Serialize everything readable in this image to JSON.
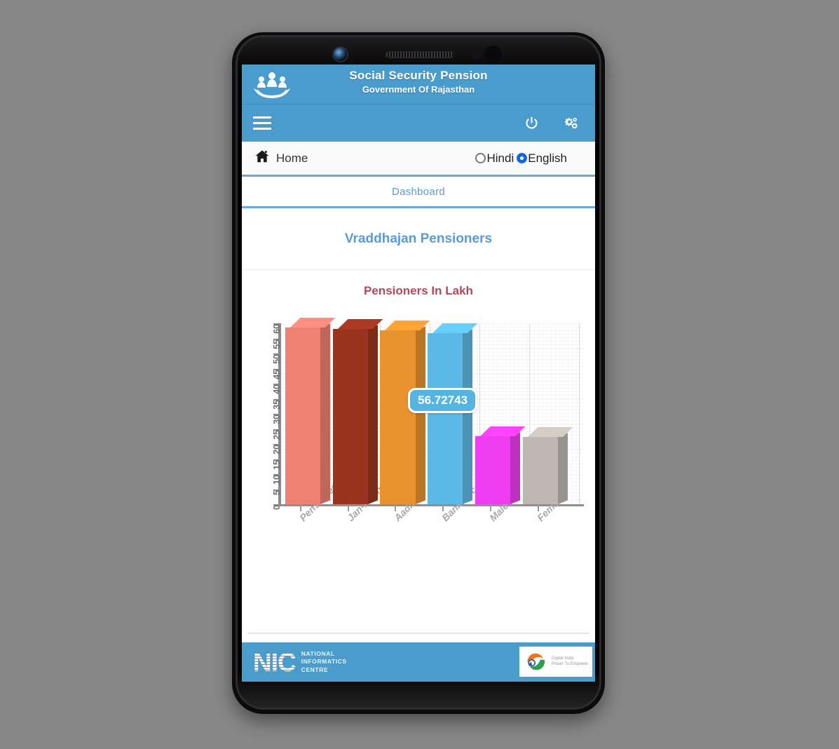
{
  "header": {
    "title": "Social Security Pension",
    "subtitle": "Government Of Rajasthan",
    "logo_name": "pension-emblem-hands-logo"
  },
  "navbar": {
    "menu_icon": "hamburger-icon",
    "power_icon": "power-icon",
    "settings_icon": "gears-icon"
  },
  "subbar": {
    "home_label": "Home",
    "home_icon": "home-icon",
    "languages": [
      {
        "label": "Hindi",
        "selected": false
      },
      {
        "label": "English",
        "selected": true
      }
    ]
  },
  "dashboard": {
    "tab_label": "Dashboard",
    "panel_title": "Vraddhajan Pensioners"
  },
  "chart_data": {
    "type": "bar",
    "title": "Pensioners In Lakh",
    "xlabel": "",
    "ylabel": "",
    "categories": [
      "Pensioner",
      "Jan-Aadhar",
      "Aadhar",
      "Bank Account",
      "Male",
      "Female"
    ],
    "values": [
      58.7,
      58.1,
      57.6,
      56.72743,
      22.5,
      22.3
    ],
    "colors": [
      "#ef8173",
      "#99341f",
      "#e8922f",
      "#5cb8e4",
      "#ee3df0",
      "#bdb8b2"
    ],
    "ylim": [
      0,
      60
    ],
    "yticks": [
      0,
      5,
      10,
      15,
      20,
      25,
      30,
      35,
      40,
      45,
      50,
      55,
      60
    ],
    "ytick_labels": [
      "0",
      "5",
      "10",
      "15",
      "20",
      "25",
      "30",
      "35",
      "40",
      "45",
      "50",
      "55",
      "60"
    ],
    "grid": true,
    "legend": "none",
    "annotations": [
      {
        "text": "56.72743",
        "attached_to": "Bank Account",
        "style": "tooltip"
      }
    ]
  },
  "footer": {
    "logo_text": "NIC",
    "org_line1": "NATIONAL",
    "org_line2": "INFORMATICS",
    "org_line3": "CENTRE",
    "badge_name": "digital-india-logo",
    "badge_line1": "Digital India",
    "badge_line2": "Power To Empower"
  },
  "colors": {
    "brand_blue": "#4a9ccd",
    "accent_link": "#5b9bd5",
    "chart_title_red": "#b5475c",
    "radio_selected": "#1168d8"
  }
}
